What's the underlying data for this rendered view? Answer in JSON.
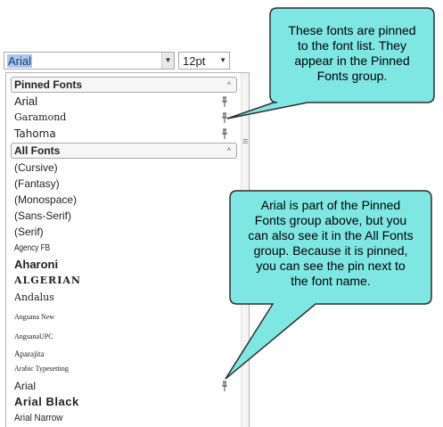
{
  "toolbar": {
    "font_value": "Arial",
    "size_value": "12pt"
  },
  "groups": {
    "pinned_label": "Pinned Fonts",
    "all_label": "All Fonts"
  },
  "pinned_fonts": [
    {
      "label": "Arial",
      "pinned": true
    },
    {
      "label": "Garamond",
      "pinned": true
    },
    {
      "label": "Tahoma",
      "pinned": true
    }
  ],
  "all_fonts": [
    {
      "label": "(Cursive)",
      "pinned": false
    },
    {
      "label": "(Fantasy)",
      "pinned": false
    },
    {
      "label": "(Monospace)",
      "pinned": false
    },
    {
      "label": "(Sans-Serif)",
      "pinned": false
    },
    {
      "label": "(Serif)",
      "pinned": false
    },
    {
      "label": "Agency FB",
      "pinned": false
    },
    {
      "label": "Aharoni",
      "pinned": false
    },
    {
      "label": "ALGERIAN",
      "pinned": false
    },
    {
      "label": "Andalus",
      "pinned": false
    },
    {
      "label": "Angsana New",
      "pinned": false
    },
    {
      "label": "AngsanaUPC",
      "pinned": false
    },
    {
      "label": "Aparajita",
      "pinned": false
    },
    {
      "label": "Arabic Typesetting",
      "pinned": false
    },
    {
      "label": "Arial",
      "pinned": true
    },
    {
      "label": "Arial Black",
      "pinned": false
    },
    {
      "label": "Arial Narrow",
      "pinned": false
    }
  ],
  "callouts": {
    "top_lines": [
      "These fonts are pinned",
      "to the font list. They",
      "appear in the Pinned",
      "Fonts group."
    ],
    "bottom_lines": [
      "Arial is part of the Pinned",
      "Fonts group above, but you",
      "can also see it in the All Fonts",
      "group. Because it is pinned,",
      "you can see the pin next to",
      "the font name."
    ]
  },
  "icons": {
    "font_dropdown": "chevron-down-icon",
    "size_dropdown": "chevron-down-icon",
    "collapse": "chevron-up-icon",
    "pin": "pin-icon",
    "scroll_grip": "scroll-grip-icon"
  },
  "colors": {
    "callout_fill": "#7fe7e3",
    "callout_stroke": "#2d2d2d",
    "selection": "#a9c7ee"
  }
}
